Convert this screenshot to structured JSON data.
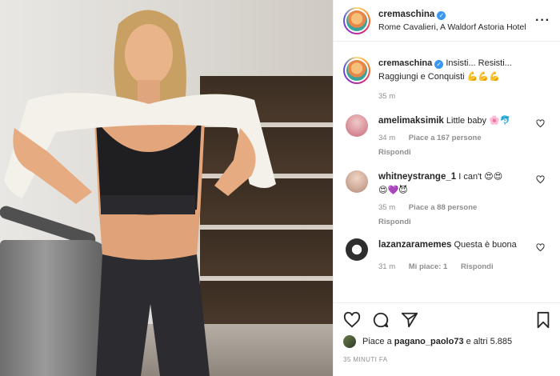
{
  "post": {
    "username": "cremaschina",
    "location": "Rome Cavalieri, A Waldorf Astoria Hotel",
    "caption_text": "Insisti... Resisti... Raggiungi e Conquisti",
    "caption_age": "35 m"
  },
  "comments": [
    {
      "username": "amelimaksimik",
      "text": "Little baby",
      "age": "34 m",
      "likes": "Piace a 167 persone",
      "reply": "Rispondi"
    },
    {
      "username": "whitneystrange_1",
      "text": "I can't",
      "age": "35 m",
      "likes": "Piace a 88 persone",
      "reply": "Rispondi"
    },
    {
      "username": "lazanzaramemes",
      "text": "Questa è buona",
      "age": "31 m",
      "likes": "Mi piace: 1",
      "reply": "Rispondi"
    }
  ],
  "footer": {
    "likes_prefix": "Piace a",
    "likes_user": "pagano_paolo73",
    "likes_suffix": "e altri 5.885",
    "timestamp": "35 MINUTI FA"
  },
  "icons": [
    "more-icon",
    "heart-icon",
    "comment-icon",
    "share-icon",
    "bookmark-icon",
    "verified-icon",
    "bicep-emoji",
    "flower-emoji",
    "heart-eyes-emoji",
    "purple-heart-emoji",
    "devil-emoji"
  ],
  "colors": {
    "verified": "#3897f0",
    "muted": "#8e8e8e",
    "text": "#262626",
    "border": "#efefef"
  }
}
